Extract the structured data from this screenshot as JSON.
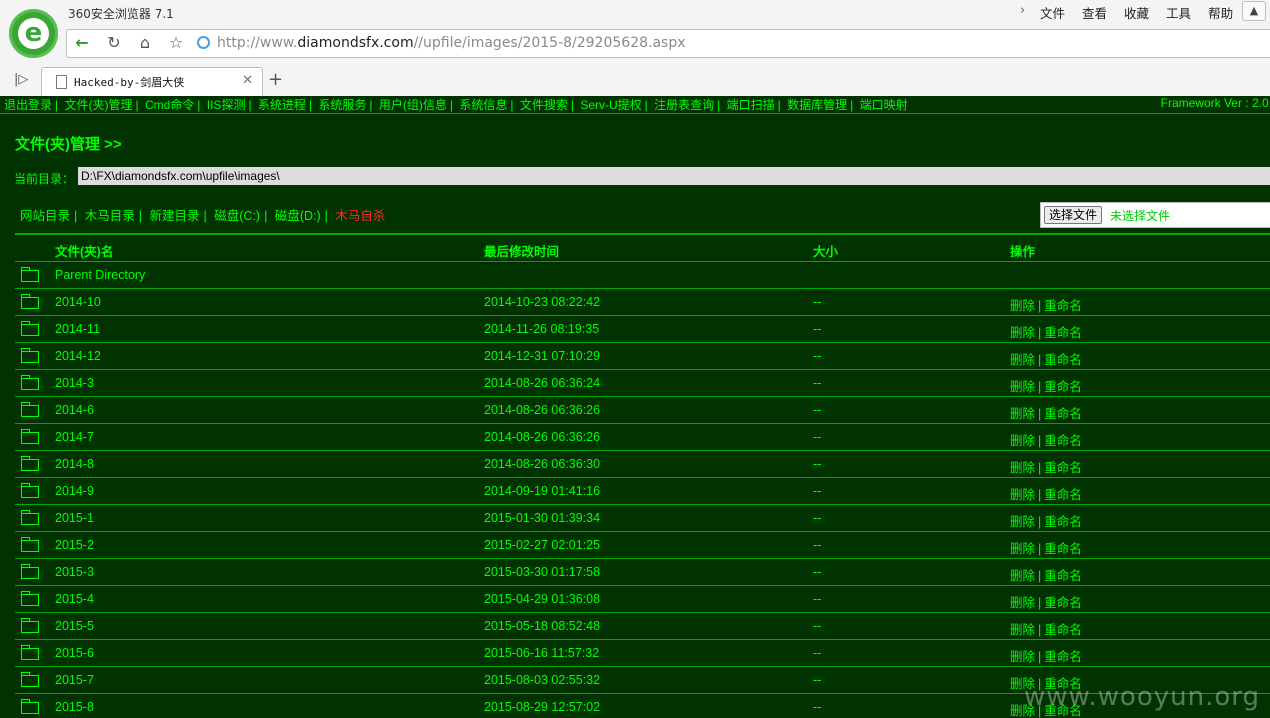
{
  "browser": {
    "app_title": "360安全浏览器 7.1",
    "menus": [
      "文件",
      "查看",
      "收藏",
      "工具",
      "帮助"
    ],
    "address": {
      "prefix": "http://www.",
      "domain": "diamondsfx.com",
      "path": "//upfile/images/2015-8/29205628.aspx"
    },
    "tab_title": "Hacked-by-剑眉大侠",
    "icons": {
      "logo": "360-browser-logo",
      "back": "back-arrow-icon",
      "reload": "reload-icon",
      "home": "home-icon",
      "favorite": "star-icon",
      "security": "globe-icon",
      "tab_page": "document-icon",
      "close_tab": "close-icon",
      "new_tab": "plus-icon",
      "sidebar": "sidebar-toggle-icon",
      "minimize": "shield-icon",
      "menu_more": "chevron-right-icon"
    }
  },
  "page": {
    "top_nav": [
      "退出登录",
      "文件(夹)管理",
      "Cmd命令",
      "IIS探测",
      "系统进程",
      "系统服务",
      "用户(组)信息",
      "系统信息",
      "文件搜索",
      "Serv-U提权",
      "注册表查询",
      "端口扫描",
      "数据库管理",
      "端口映射"
    ],
    "framework": "Framework Ver : 2.0.",
    "title": "文件(夹)管理 >>",
    "current_dir_label": "当前目录：",
    "current_dir_value": "D:\\FX\\diamondsfx.com\\upfile\\images\\",
    "quick_links": [
      "网站目录",
      "木马目录",
      "新建目录",
      "磁盘(C:)",
      "磁盘(D:)"
    ],
    "trojan_link": "木马自杀",
    "upload": {
      "choose_label": "选择文件",
      "no_file": "未选择文件"
    },
    "table": {
      "headers": [
        "文件(夹)名",
        "最后修改时间",
        "大小",
        "操作"
      ],
      "parent": "Parent Directory",
      "rows": [
        {
          "name": "2014-10",
          "date": "2014-10-23 08:22:42",
          "size": "--"
        },
        {
          "name": "2014-11",
          "date": "2014-11-26 08:19:35",
          "size": "--"
        },
        {
          "name": "2014-12",
          "date": "2014-12-31 07:10:29",
          "size": "--"
        },
        {
          "name": "2014-3",
          "date": "2014-08-26 06:36:24",
          "size": "--"
        },
        {
          "name": "2014-6",
          "date": "2014-08-26 06:36:26",
          "size": "--"
        },
        {
          "name": "2014-7",
          "date": "2014-08-26 06:36:26",
          "size": "--"
        },
        {
          "name": "2014-8",
          "date": "2014-08-26 06:36:30",
          "size": "--"
        },
        {
          "name": "2014-9",
          "date": "2014-09-19 01:41:16",
          "size": "--"
        },
        {
          "name": "2015-1",
          "date": "2015-01-30 01:39:34",
          "size": "--"
        },
        {
          "name": "2015-2",
          "date": "2015-02-27 02:01:25",
          "size": "--"
        },
        {
          "name": "2015-3",
          "date": "2015-03-30 01:17:58",
          "size": "--"
        },
        {
          "name": "2015-4",
          "date": "2015-04-29 01:36:08",
          "size": "--"
        },
        {
          "name": "2015-5",
          "date": "2015-05-18 08:52:48",
          "size": "--"
        },
        {
          "name": "2015-6",
          "date": "2015-06-16 11:57:32",
          "size": "--"
        },
        {
          "name": "2015-7",
          "date": "2015-08-03 02:55:32",
          "size": "--"
        },
        {
          "name": "2015-8",
          "date": "2015-08-29 12:57:02",
          "size": "--"
        }
      ],
      "delete_label": "删除",
      "rename_label": "重命名"
    },
    "watermark": "www.wooyun.org",
    "colors": {
      "background": "#003300",
      "text": "#00ff00",
      "trojan_link": "#ff2a2a"
    }
  }
}
